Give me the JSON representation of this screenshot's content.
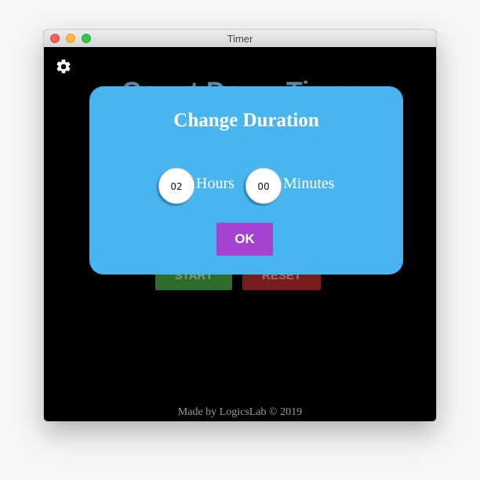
{
  "window": {
    "title": "Timer"
  },
  "app": {
    "title": "Count Down Timer",
    "start_label": "START",
    "reset_label": "RESET",
    "footer": "Made by LogicsLab © 2019",
    "settings_icon": "gear-icon"
  },
  "modal": {
    "title": "Change Duration",
    "hours_value": "02",
    "hours_label": "Hours",
    "minutes_value": "00",
    "minutes_label": "Minutes",
    "ok_label": "OK"
  },
  "colors": {
    "modal_background": "#48b5ee",
    "ok_button": "#a443cf",
    "start_button": "#2f6b2a",
    "reset_button": "#761e1e",
    "app_background": "#000000"
  }
}
